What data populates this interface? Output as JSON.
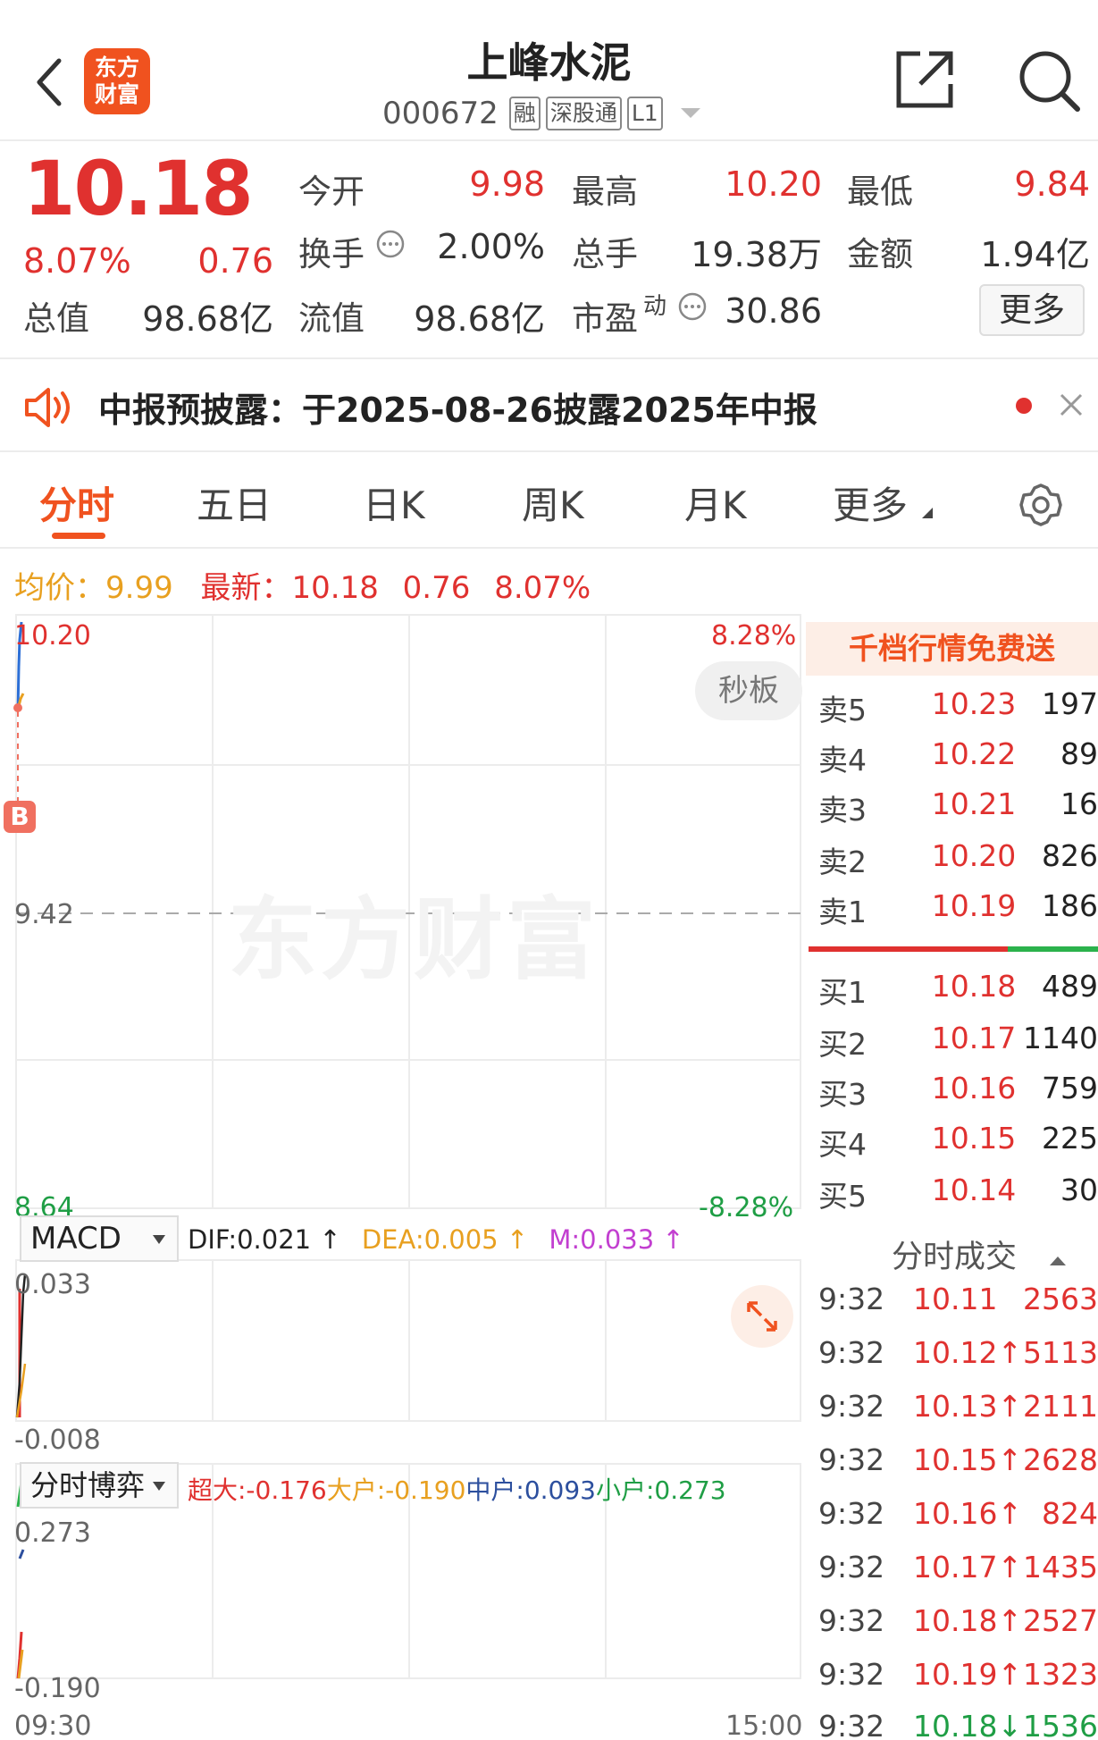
{
  "header": {
    "logo_text": "东方财富",
    "title": "上峰水泥",
    "code": "000672",
    "tags": [
      "融",
      "深股通",
      "L1"
    ]
  },
  "quote": {
    "price": "10.18",
    "change_pct": "8.07%",
    "change": "0.76",
    "open_label": "今开",
    "open": "9.98",
    "high_label": "最高",
    "high": "10.20",
    "low_label": "最低",
    "low": "9.84",
    "turnover_label": "换手",
    "turnover": "2.00%",
    "volume_label": "总手",
    "volume": "19.38万",
    "amount_label": "金额",
    "amount": "1.94亿",
    "mktcap_label": "总值",
    "mktcap": "98.68亿",
    "float_label": "流值",
    "float_cap": "98.68亿",
    "pe_label": "市盈",
    "pe_sup": "动",
    "pe": "30.86",
    "more_label": "更多"
  },
  "notice": {
    "text": "中报预披露：于2025-08-26披露2025年中报"
  },
  "tabs": [
    "分时",
    "五日",
    "日K",
    "周K",
    "月K",
    "更多"
  ],
  "info": {
    "avg_label": "均价：",
    "avg": "9.99",
    "latest_label": "最新：",
    "latest": "10.18",
    "change": "0.76",
    "change_pct": "8.07%"
  },
  "chart": {
    "y_top": "10.20",
    "y_mid": "9.42",
    "y_bottom": "8.64",
    "pct_top": "8.28%",
    "pct_bottom": "-8.28%",
    "second_board": "秒板",
    "b_marker": "B",
    "watermark": "东方财富",
    "x_start": "09:30",
    "x_end": "15:00"
  },
  "macd": {
    "name": "MACD",
    "dif": "DIF:0.021 ↑",
    "dea": "DEA:0.005 ↑",
    "m": "M:0.033 ↑",
    "y_top": "0.033",
    "y_bottom": "-0.008"
  },
  "game": {
    "name": "分时博弈",
    "super": "超大:-0.176",
    "large": "大户:-0.190",
    "mid": "中户:0.093",
    "small": "小户:0.273",
    "y_top": "0.273",
    "y_bottom": "-0.190"
  },
  "orderbook": {
    "free_label": "千档行情免费送",
    "asks": [
      {
        "k": "卖5",
        "p": "10.23",
        "v": "197"
      },
      {
        "k": "卖4",
        "p": "10.22",
        "v": "89"
      },
      {
        "k": "卖3",
        "p": "10.21",
        "v": "16"
      },
      {
        "k": "卖2",
        "p": "10.20",
        "v": "826"
      },
      {
        "k": "卖1",
        "p": "10.19",
        "v": "186"
      }
    ],
    "bids": [
      {
        "k": "买1",
        "p": "10.18",
        "v": "489"
      },
      {
        "k": "买2",
        "p": "10.17",
        "v": "1140"
      },
      {
        "k": "买3",
        "p": "10.16",
        "v": "759"
      },
      {
        "k": "买4",
        "p": "10.15",
        "v": "225"
      },
      {
        "k": "买5",
        "p": "10.14",
        "v": "30"
      }
    ]
  },
  "trades": {
    "header": "分时成交",
    "rows": [
      {
        "t": "9:32",
        "p": "10.11",
        "v": "2563"
      },
      {
        "t": "9:32",
        "p": "10.12↑",
        "v": "5113"
      },
      {
        "t": "9:32",
        "p": "10.13↑",
        "v": "2111"
      },
      {
        "t": "9:32",
        "p": "10.15↑",
        "v": "2628"
      },
      {
        "t": "9:32",
        "p": "10.16↑",
        "v": "824"
      },
      {
        "t": "9:32",
        "p": "10.17↑",
        "v": "1435"
      },
      {
        "t": "9:32",
        "p": "10.18↑",
        "v": "2527"
      },
      {
        "t": "9:32",
        "p": "10.19↑",
        "v": "1323"
      },
      {
        "t": "9:32",
        "p": "10.18↓",
        "v": "1536"
      }
    ]
  }
}
